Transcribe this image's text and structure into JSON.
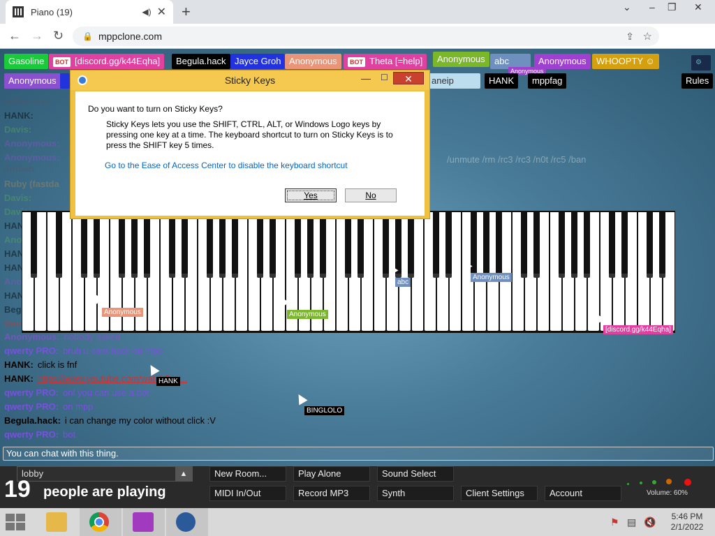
{
  "browser": {
    "tab_title": "Piano (19)",
    "tab_audio_icon": "speaker-icon",
    "tab_close": "✕",
    "new_tab": "+",
    "url": "mppclone.com"
  },
  "top_names": [
    {
      "label": "Gasoline",
      "color": "#1aca3a",
      "bot": false
    },
    {
      "label": "[discord.gg/k44Eqha]",
      "color": "#e040a0",
      "bot": true
    },
    {
      "label": "Begula.hack",
      "color": "#000000",
      "bot": false
    },
    {
      "label": "Jayce Groh",
      "color": "#2233dd",
      "bot": false
    },
    {
      "label": "Anonymous",
      "color": "#e8957a",
      "bot": false
    },
    {
      "label": "Theta [=help]",
      "color": "#e040a0",
      "bot": true
    },
    {
      "label": "Anonymous",
      "color": "#7ab82a",
      "bot": false
    },
    {
      "label": "abc",
      "color": "#6f8fbf",
      "bot": false
    },
    {
      "label": "Anonymous",
      "color": "#a040d0",
      "bot": false
    },
    {
      "label": "WHOOPTY",
      "color": "#d4a010",
      "bot": false
    }
  ],
  "second_names": [
    {
      "label": "Anonymous",
      "color": "#8a50d0"
    },
    {
      "label": "HANK",
      "color": "#000000"
    },
    {
      "label": "mppfag",
      "color": "#000000"
    },
    {
      "label": "Rules",
      "color": "#000000"
    }
  ],
  "overlay_text": {
    "help": "aneip",
    "tiny": "Anonymous",
    "commands": "/unmute /rm /rc3 /rc3 /n0t /rc5 /ban"
  },
  "chat": [
    {
      "who": "qwerty PRO:",
      "msg": "bruh u cant hack on mpp",
      "color": "#7a50e0"
    },
    {
      "who": "HANK:",
      "msg": "click is fnf",
      "color": "#000000"
    },
    {
      "who": "HANK:",
      "msg": "https://www.youtube.com/watch?v=...",
      "color": "#000000",
      "link": true
    },
    {
      "who": "qwerty PRO:",
      "msg": "onl you can use a bot",
      "color": "#7a50e0"
    },
    {
      "who": "qwerty PRO:",
      "msg": "on mpp",
      "color": "#7a50e0"
    },
    {
      "who": "Begula.hack:",
      "msg": "i can change my color without click :V",
      "color": "#000000"
    },
    {
      "who": "qwerty PRO:",
      "msg": "bot",
      "color": "#7a50e0"
    }
  ],
  "faded_chat": [
    {
      "who": "collab.um:",
      "msg": "",
      "color": "#556"
    },
    {
      "who": "HANK:",
      "msg": "",
      "color": "#000"
    },
    {
      "who": "Davis:",
      "msg": "",
      "color": "#5a5"
    },
    {
      "who": "Anonymous:",
      "msg": "",
      "color": "#8a50d0"
    },
    {
      "who": "Anonymous:",
      "msg": "",
      "color": "#8a50d0"
    },
    {
      "who": "/unban",
      "msg": "",
      "color": "#556"
    },
    {
      "who": "Ruby (fastda",
      "msg": "",
      "color": "#a85"
    },
    {
      "who": "Davis:",
      "msg": "",
      "color": "#5a5"
    },
    {
      "who": "Davis:",
      "msg": "",
      "color": "#5a5"
    },
    {
      "who": "HANK:",
      "msg": "",
      "color": "#000"
    },
    {
      "who": "Anon:",
      "msg": "",
      "color": "#5a5"
    },
    {
      "who": "HANK:",
      "msg": "",
      "color": "#000"
    },
    {
      "who": "HANK:",
      "msg": "",
      "color": "#000"
    },
    {
      "who": "Anon:",
      "msg": "",
      "color": "#8a50d0"
    },
    {
      "who": "HANK:",
      "msg": "",
      "color": "#000"
    },
    {
      "who": "Begula:",
      "msg": "",
      "color": "#000"
    },
    {
      "who": "Davi:",
      "msg": "",
      "color": "#c33"
    },
    {
      "who": "Anonymous:",
      "msg": "nobody asked",
      "color": "#8a50d0"
    }
  ],
  "piano_cursors": [
    {
      "label": "Anonymous",
      "color": "#e8957a"
    },
    {
      "label": "Anonymous",
      "color": "#7ab82a"
    },
    {
      "label": "abc",
      "color": "#6f8fbf"
    },
    {
      "label": "Anonymous",
      "color": "#6f8fbf"
    },
    {
      "label": "[discord.gg/k44Eqha]",
      "color": "#e040a0"
    },
    {
      "label": "HANK",
      "color": "#000000"
    },
    {
      "label": "BINGLOLO",
      "color": "#000000"
    }
  ],
  "chat_input_placeholder": "You can chat with this thing.",
  "bottom": {
    "room": "lobby",
    "room_arrow": "▲",
    "count": "19",
    "count_text": "people are playing",
    "buttons_row1": [
      "New Room...",
      "Play Alone",
      "Sound Select"
    ],
    "buttons_row2": [
      "MIDI In/Out",
      "Record MP3",
      "Synth",
      "Client Settings",
      "Account"
    ],
    "volume": "Volume: 60%"
  },
  "dialog": {
    "title": "Sticky Keys",
    "question": "Do you want to turn on Sticky Keys?",
    "description": "Sticky Keys lets you use the SHIFT, CTRL, ALT, or Windows Logo keys by pressing one key at a time. The keyboard shortcut to turn on Sticky Keys is to press the SHIFT key 5 times.",
    "link": "Go to the Ease of Access Center to disable the keyboard shortcut",
    "yes": "Yes",
    "no": "No"
  },
  "taskbar": {
    "time": "5:46 PM",
    "date": "2/1/2022"
  }
}
